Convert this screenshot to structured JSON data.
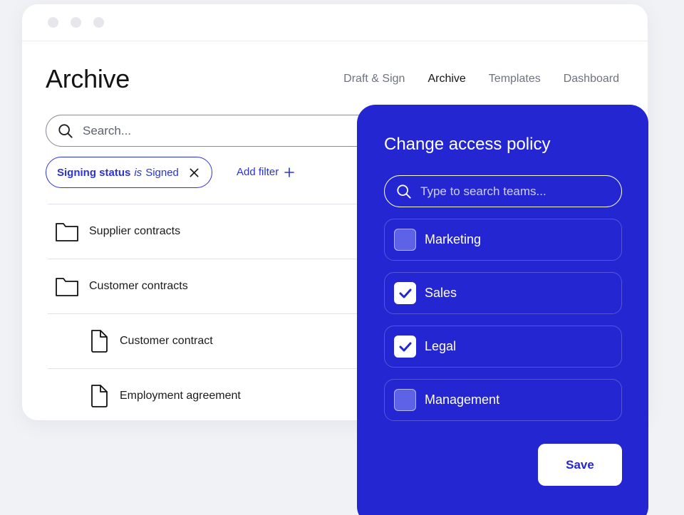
{
  "header": {
    "title": "Archive",
    "nav": [
      {
        "label": "Draft & Sign",
        "active": false
      },
      {
        "label": "Archive",
        "active": true
      },
      {
        "label": "Templates",
        "active": false
      },
      {
        "label": "Dashboard",
        "active": false
      }
    ]
  },
  "search": {
    "placeholder": "Search...",
    "icon": "search-icon"
  },
  "filter_chip": {
    "field": "Signing status",
    "operator": "is",
    "value": "Signed",
    "icon": "close-icon"
  },
  "add_filter": {
    "label": "Add filter",
    "icon": "plus-icon"
  },
  "list": [
    {
      "label": "Supplier contracts",
      "type": "folder"
    },
    {
      "label": "Customer contracts",
      "type": "folder"
    },
    {
      "label": "Customer contract",
      "type": "file"
    },
    {
      "label": "Employment agreement",
      "type": "file"
    }
  ],
  "panel": {
    "title": "Change access policy",
    "search_placeholder": "Type to search teams...",
    "teams": [
      {
        "label": "Marketing",
        "checked": false
      },
      {
        "label": "Sales",
        "checked": true
      },
      {
        "label": "Legal",
        "checked": true
      },
      {
        "label": "Management",
        "checked": false
      }
    ],
    "save_label": "Save"
  },
  "colors": {
    "accent": "#2b33d6",
    "panel": "#2426d2",
    "background": "#f1f2f6"
  }
}
